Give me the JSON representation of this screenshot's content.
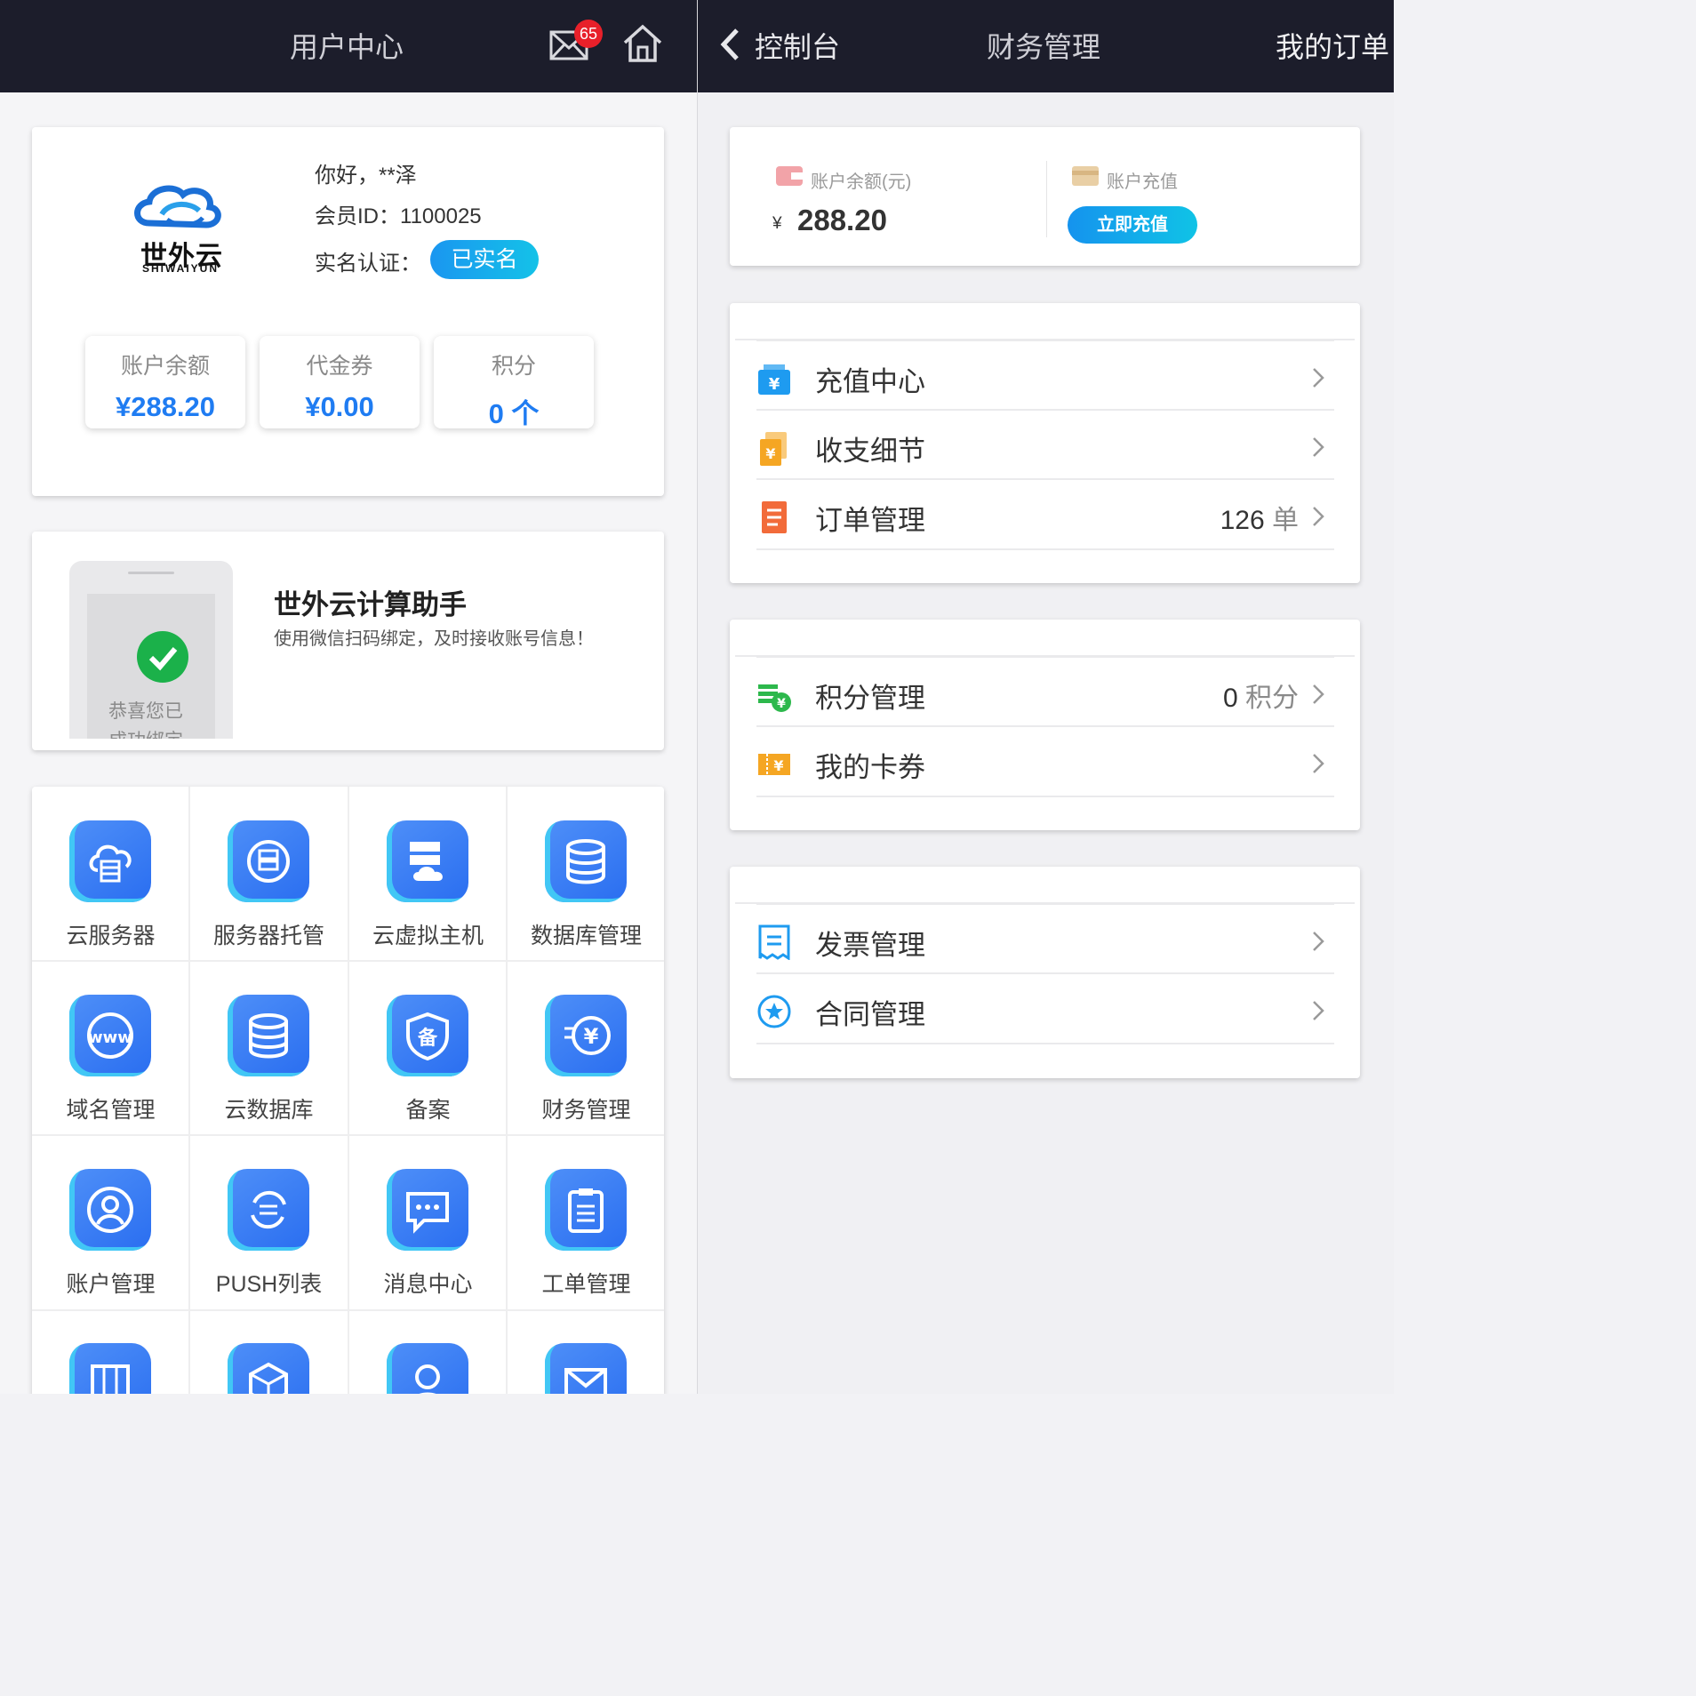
{
  "left": {
    "header": {
      "title": "用户中心",
      "mail_badge": "65"
    },
    "user": {
      "greeting": "你好，**泽",
      "member_id": "会员ID：1100025",
      "realname_label": "实名认证：",
      "realname_status": "已实名",
      "logo_brand": "世外云",
      "logo_sub": "SHIWAIYUN"
    },
    "stats": [
      {
        "label": "账户余额",
        "value": "¥288.20"
      },
      {
        "label": "代金券",
        "value": "¥0.00"
      },
      {
        "label": "积分",
        "value": "0 个"
      }
    ],
    "wechat": {
      "title": "世外云计算助手",
      "desc": "使用微信扫码绑定，及时接收账号信息！",
      "bind_line1": "恭喜您已",
      "bind_line2": "成功绑定"
    },
    "grid": [
      {
        "label": "云服务器",
        "icon": "cloud-server-icon"
      },
      {
        "label": "服务器托管",
        "icon": "server-hosting-icon"
      },
      {
        "label": "云虚拟主机",
        "icon": "virtual-host-icon"
      },
      {
        "label": "数据库管理",
        "icon": "database-icon"
      },
      {
        "label": "域名管理",
        "icon": "www-icon"
      },
      {
        "label": "云数据库",
        "icon": "cloud-database-icon"
      },
      {
        "label": "备案",
        "icon": "beian-shield-icon"
      },
      {
        "label": "财务管理",
        "icon": "finance-icon"
      },
      {
        "label": "账户管理",
        "icon": "account-icon"
      },
      {
        "label": "PUSH列表",
        "icon": "push-icon"
      },
      {
        "label": "消息中心",
        "icon": "message-icon"
      },
      {
        "label": "工单管理",
        "icon": "ticket-icon"
      },
      {
        "label": "",
        "icon": "list-icon"
      },
      {
        "label": "",
        "icon": "cube-icon"
      },
      {
        "label": "",
        "icon": "support-icon"
      },
      {
        "label": "",
        "icon": "mail-icon"
      }
    ]
  },
  "right": {
    "header": {
      "back": "控制台",
      "title": "财务管理",
      "orders": "我的订单"
    },
    "balance": {
      "label": "账户余额(元)",
      "currency": "¥",
      "value": "288.20",
      "charge_label": "账户充值",
      "charge_button": "立即充值"
    },
    "menu1": [
      {
        "label": "充值中心",
        "value": "",
        "unit": "",
        "icon": "recharge-icon",
        "color": "#1e9bf0"
      },
      {
        "label": "收支细节",
        "value": "",
        "unit": "",
        "icon": "income-expense-icon",
        "color": "#f5a623"
      },
      {
        "label": "订单管理",
        "value": "126",
        "unit": "单",
        "icon": "order-icon",
        "color": "#f26b3a"
      }
    ],
    "menu2": [
      {
        "label": "积分管理",
        "value": "0",
        "unit": "积分",
        "icon": "points-icon",
        "color": "#2db84c"
      },
      {
        "label": "我的卡券",
        "value": "",
        "unit": "",
        "icon": "coupon-icon",
        "color": "#f5a623"
      }
    ],
    "menu3": [
      {
        "label": "发票管理",
        "value": "",
        "unit": "",
        "icon": "invoice-icon",
        "color": "#1e9bf0"
      },
      {
        "label": "合同管理",
        "value": "",
        "unit": "",
        "icon": "contract-icon",
        "color": "#1e9bf0"
      }
    ]
  }
}
